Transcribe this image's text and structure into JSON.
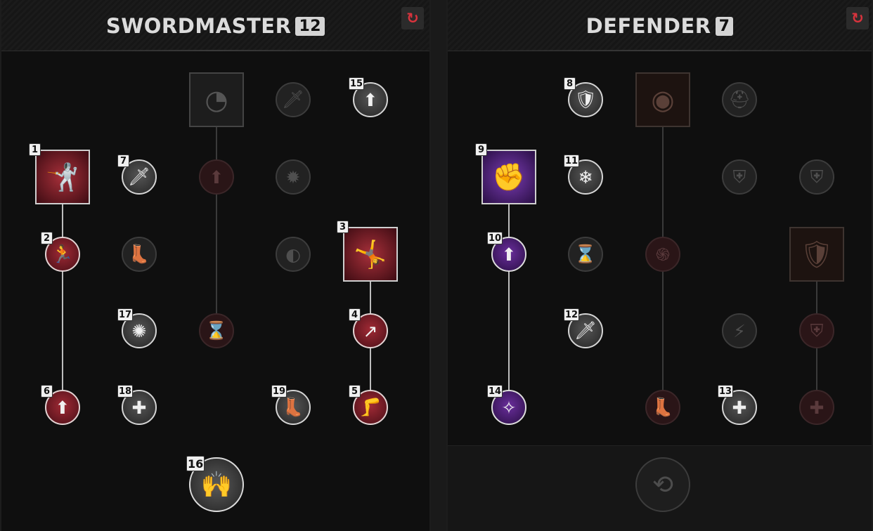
{
  "left": {
    "title": "SWORDMASTER",
    "level": "12",
    "reset_icon": "reset-icon",
    "nodes": [
      {
        "id": "sm-sq-1",
        "badge": "1",
        "icon": "lunging-swordsman-icon",
        "glyph": "🤺",
        "state": "active-red"
      },
      {
        "id": "sm-c-2",
        "badge": "2",
        "icon": "dodging-figure-icon",
        "glyph": "🏃",
        "state": "active-red"
      },
      {
        "id": "sm-c-6",
        "badge": "6",
        "icon": "arrow-up-burst-icon",
        "glyph": "⬆",
        "state": "active-red"
      },
      {
        "id": "sm-c-7",
        "badge": "7",
        "icon": "sword-sparkle-icon",
        "glyph": "🗡",
        "state": "active-grey"
      },
      {
        "id": "sm-c-17",
        "badge": "17",
        "icon": "sunburst-icon",
        "glyph": "✺",
        "state": "active-grey"
      },
      {
        "id": "sm-c-18",
        "badge": "18",
        "icon": "cross-burst-icon",
        "glyph": "✚",
        "state": "active-grey"
      },
      {
        "id": "sm-c-boot",
        "badge": "",
        "icon": "boot-arrow-icon",
        "glyph": "👢",
        "state": "locked"
      },
      {
        "id": "sm-sq-blade",
        "badge": "",
        "icon": "circular-slash-icon",
        "glyph": "◔",
        "state": "locked"
      },
      {
        "id": "sm-c-upburst",
        "badge": "",
        "icon": "arrow-up-burst-icon",
        "glyph": "⬆",
        "state": "locked-red"
      },
      {
        "id": "sm-c-hourglass",
        "badge": "",
        "icon": "hourglass-down-icon",
        "glyph": "⌛",
        "state": "locked-red"
      },
      {
        "id": "sm-c-sword",
        "badge": "",
        "icon": "sword-slash-icon",
        "glyph": "🗡",
        "state": "locked"
      },
      {
        "id": "sm-c-whirl",
        "badge": "",
        "icon": "whirlwind-icon",
        "glyph": "✹",
        "state": "locked"
      },
      {
        "id": "sm-c-wave",
        "badge": "",
        "icon": "wave-shield-icon",
        "glyph": "◐",
        "state": "locked"
      },
      {
        "id": "sm-c-19",
        "badge": "19",
        "icon": "winged-boot-icon",
        "glyph": "👢",
        "state": "active-grey"
      },
      {
        "id": "sm-c-15",
        "badge": "15",
        "icon": "arrow-up-burst-icon",
        "glyph": "⬆",
        "state": "active-grey"
      },
      {
        "id": "sm-sq-3",
        "badge": "3",
        "icon": "leaping-swordsman-icon",
        "glyph": "🤸",
        "state": "active-red"
      },
      {
        "id": "sm-c-4",
        "badge": "4",
        "icon": "arrow-diagonal-up-icon",
        "glyph": "↗",
        "state": "active-red"
      },
      {
        "id": "sm-c-5",
        "badge": "5",
        "icon": "boot-kick-icon",
        "glyph": "🦵",
        "state": "active-red"
      },
      {
        "id": "sm-big-16",
        "badge": "16",
        "icon": "glowing-figure-icon",
        "glyph": "🙌",
        "state": "active"
      }
    ]
  },
  "right": {
    "title": "DEFENDER",
    "level": "7",
    "reset_icon": "reset-icon",
    "nodes": [
      {
        "id": "df-sq-9",
        "badge": "9",
        "icon": "shield-bash-fist-icon",
        "glyph": "✊",
        "state": "active-purple"
      },
      {
        "id": "df-c-10",
        "badge": "10",
        "icon": "arrow-up-burst-icon",
        "glyph": "⬆",
        "state": "active-purple"
      },
      {
        "id": "df-c-14",
        "badge": "14",
        "icon": "orbit-sparkle-icon",
        "glyph": "✧",
        "state": "active-purple"
      },
      {
        "id": "df-c-8",
        "badge": "8",
        "icon": "chest-armor-icon",
        "glyph": "🛡",
        "state": "active-grey"
      },
      {
        "id": "df-c-11",
        "badge": "11",
        "icon": "shield-frost-icon",
        "glyph": "❄",
        "state": "active-grey"
      },
      {
        "id": "df-c-hourglass",
        "badge": "",
        "icon": "hourglass-icon",
        "glyph": "⌛",
        "state": "locked"
      },
      {
        "id": "df-c-12",
        "badge": "12",
        "icon": "flaming-sword-icon",
        "glyph": "🗡",
        "state": "active-grey"
      },
      {
        "id": "df-sq-shieldcharge",
        "badge": "",
        "icon": "shield-charge-icon",
        "glyph": "◉",
        "state": "locked-red"
      },
      {
        "id": "df-c-spiral",
        "badge": "",
        "icon": "spiral-icon",
        "glyph": "֍",
        "state": "locked-red"
      },
      {
        "id": "df-c-boot",
        "badge": "",
        "icon": "boot-icon",
        "glyph": "👢",
        "state": "locked-red"
      },
      {
        "id": "df-c-helm",
        "badge": "",
        "icon": "helmet-icon",
        "glyph": "⛑",
        "state": "locked"
      },
      {
        "id": "df-c-shield1",
        "badge": "",
        "icon": "shield-emblem-icon",
        "glyph": "⛨",
        "state": "locked"
      },
      {
        "id": "df-c-lightning",
        "badge": "",
        "icon": "lightning-icon",
        "glyph": "⚡",
        "state": "locked"
      },
      {
        "id": "df-c-13",
        "badge": "13",
        "icon": "plus-cross-icon",
        "glyph": "✚",
        "state": "active-grey"
      },
      {
        "id": "df-c-shield2",
        "badge": "",
        "icon": "shield-slash-icon",
        "glyph": "⛨",
        "state": "locked"
      },
      {
        "id": "df-sq-bigshield",
        "badge": "",
        "icon": "large-shield-icon",
        "glyph": "🛡",
        "state": "locked-red"
      },
      {
        "id": "df-c-shield3",
        "badge": "",
        "icon": "shield-check-icon",
        "glyph": "⛨",
        "state": "locked-red"
      },
      {
        "id": "df-c-cross",
        "badge": "",
        "icon": "cross-icon",
        "glyph": "✚",
        "state": "locked-red"
      },
      {
        "id": "df-big-ring",
        "badge": "",
        "icon": "rotating-ring-icon",
        "glyph": "⟲",
        "state": "locked"
      }
    ]
  }
}
